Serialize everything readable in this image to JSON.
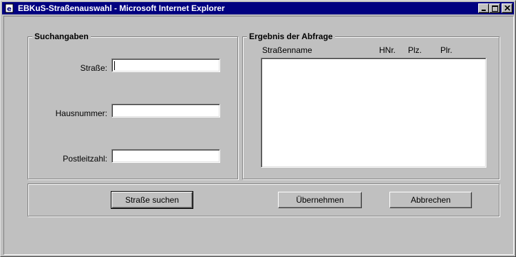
{
  "window": {
    "title": "EBKuS-Straßenauswahl - Microsoft Internet Explorer",
    "icon": "ie-page-icon"
  },
  "search": {
    "legend": "Suchangaben",
    "street_label": "Straße:",
    "street_value": "",
    "housenumber_label": "Hausnummer:",
    "housenumber_value": "",
    "postcode_label": "Postleitzahl:",
    "postcode_value": ""
  },
  "results": {
    "legend": "Ergebnis der Abfrage",
    "columns": [
      "Straßenname",
      "HNr.",
      "Plz.",
      "Plr."
    ],
    "rows": []
  },
  "buttons": {
    "search": "Straße suchen",
    "accept": "Übernehmen",
    "cancel": "Abbrechen"
  }
}
